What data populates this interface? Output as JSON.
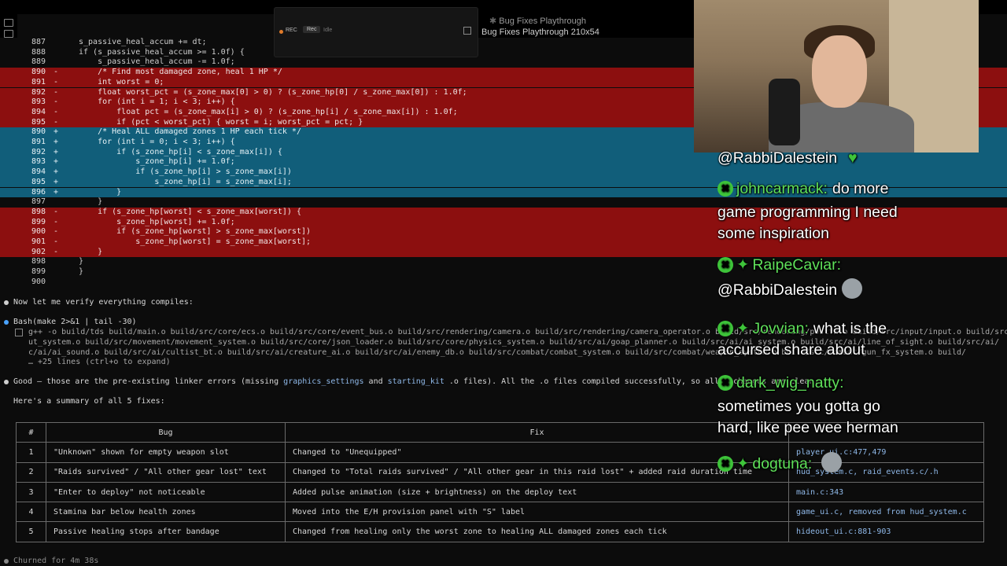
{
  "window": {
    "title": "Bug Fixes Playthrough",
    "subtitle": "Bug Fixes Playthrough 210x54"
  },
  "recorder": {
    "rec_label": "REC",
    "rec_button": "Rec",
    "idle_label": "Idle"
  },
  "diff_lines": [
    {
      "kind": "ctx",
      "ln": "887",
      "sign": "",
      "code": "s_passive_heal_accum += dt;"
    },
    {
      "kind": "ctx",
      "ln": "888",
      "sign": "",
      "code": "if (s_passive_heal_accum >= 1.0f) {"
    },
    {
      "kind": "ctx",
      "ln": "889",
      "sign": "",
      "code": "    s_passive_heal_accum -= 1.0f;"
    },
    {
      "kind": "del",
      "ln": "890",
      "sign": "-",
      "code": "    /* Find most damaged zone, heal 1 HP */"
    },
    {
      "kind": "del",
      "ln": "891",
      "sign": "-",
      "code": "    int worst = 0;"
    },
    {
      "kind": "del",
      "ln": "892",
      "sign": "-",
      "code": "    float worst_pct = (s_zone_max[0] > 0) ? (s_zone_hp[0] / s_zone_max[0]) : 1.0f;"
    },
    {
      "kind": "del",
      "ln": "893",
      "sign": "-",
      "code": "    for (int i = 1; i < 3; i++) {"
    },
    {
      "kind": "del",
      "ln": "894",
      "sign": "-",
      "code": "        float pct = (s_zone_max[i] > 0) ? (s_zone_hp[i] / s_zone_max[i]) : 1.0f;"
    },
    {
      "kind": "del",
      "ln": "895",
      "sign": "-",
      "code": "        if (pct < worst_pct) { worst = i; worst_pct = pct; }"
    },
    {
      "kind": "add",
      "ln": "890",
      "sign": "+",
      "code": "    /* Heal ALL damaged zones 1 HP each tick */"
    },
    {
      "kind": "add",
      "ln": "891",
      "sign": "+",
      "code": "    for (int i = 0; i < 3; i++) {"
    },
    {
      "kind": "add",
      "ln": "892",
      "sign": "+",
      "code": "        if (s_zone_hp[i] < s_zone_max[i]) {"
    },
    {
      "kind": "add",
      "ln": "893",
      "sign": "+",
      "code": "            s_zone_hp[i] += 1.0f;"
    },
    {
      "kind": "add",
      "ln": "894",
      "sign": "+",
      "code": "            if (s_zone_hp[i] > s_zone_max[i])"
    },
    {
      "kind": "add",
      "ln": "895",
      "sign": "+",
      "code": "                s_zone_hp[i] = s_zone_max[i];"
    },
    {
      "kind": "add",
      "ln": "896",
      "sign": "+",
      "code": "        }"
    },
    {
      "kind": "ctx",
      "ln": "897",
      "sign": "",
      "code": "    }"
    },
    {
      "kind": "del",
      "ln": "898",
      "sign": "-",
      "code": "    if (s_zone_hp[worst] < s_zone_max[worst]) {"
    },
    {
      "kind": "del",
      "ln": "899",
      "sign": "-",
      "code": "        s_zone_hp[worst] += 1.0f;"
    },
    {
      "kind": "del",
      "ln": "900",
      "sign": "-",
      "code": "        if (s_zone_hp[worst] > s_zone_max[worst])"
    },
    {
      "kind": "del",
      "ln": "901",
      "sign": "-",
      "code": "            s_zone_hp[worst] = s_zone_max[worst];"
    },
    {
      "kind": "del",
      "ln": "902",
      "sign": "-",
      "code": "    }"
    },
    {
      "kind": "ctx",
      "ln": "898",
      "sign": "",
      "code": "}"
    },
    {
      "kind": "ctx",
      "ln": "899",
      "sign": "",
      "code": "}"
    },
    {
      "kind": "ctx",
      "ln": "900",
      "sign": "",
      "code": ""
    }
  ],
  "messages": {
    "verify": "Now let me verify everything compiles:",
    "bash_cmd": "Bash(make 2>&1 | tail -30)",
    "bash_out_1": "g++ -o build/tds build/main.o build/src/core/ecs.o build/src/core/event_bus.o build/src/rendering/camera.o build/src/rendering/camera_operator.o build/src/rendering/postfx.o build/src/input/input.o build/src/input",
    "bash_out_2": "ut_system.o build/src/movement/movement_system.o build/src/core/json_loader.o build/src/core/physics_system.o build/src/ai/goap_planner.o build/src/ai/ai_system.o build/src/ai/line_of_sight.o build/src/ai/",
    "bash_out_3": "c/ai/ai_sound.o build/src/ai/cultist_bt.o build/src/ai/creature_ai.o build/src/ai/enemy_db.o build/src/combat/combat_system.o build/src/combat/weapon_system.o build/src/combat/gun_fx_system.o build/",
    "bash_more": "… +25 lines (ctrl+o to expand)",
    "good_pre": "Good — those are the pre-existing linker errors (missing ",
    "good_h1": "graphics_settings",
    "good_mid": " and ",
    "good_h2": "starting_kit",
    "good_post": " .o files). All the .o files compiled successfully, so all 5 changes are clean.",
    "summary": "Here's a summary of all 5 fixes:",
    "churned": "Churned for 4m 38s"
  },
  "table": {
    "headers": [
      "#",
      "Bug",
      "Fix",
      ""
    ],
    "rows": [
      {
        "num": "1",
        "bug": "\"Unknown\" shown for empty weapon slot",
        "fix": "Changed to \"Unequipped\"",
        "file": "player_ui.c:477,479"
      },
      {
        "num": "2",
        "bug": "\"Raids survived\" / \"All other gear lost\" text",
        "fix": "Changed to \"Total raids survived\" / \"All other gear in this raid lost\" + added raid duration time",
        "file": "hud_system.c, raid_events.c/.h"
      },
      {
        "num": "3",
        "bug": "\"Enter to deploy\" not noticeable",
        "fix": "Added pulse animation (size + brightness) on the deploy text",
        "file": "main.c:343"
      },
      {
        "num": "4",
        "bug": "Stamina bar below health zones",
        "fix": "Moved into the E/H provision panel with \"S\" label",
        "file": "game_ui.c, removed from hud_system.c"
      },
      {
        "num": "5",
        "bug": "Passive healing stops after bandage",
        "fix": "Changed from healing only the worst zone to healing ALL damaged zones each tick",
        "file": "hideout_ui.c:881-903"
      }
    ]
  },
  "chat": [
    {
      "user": "@RabbiDalestein",
      "text": "",
      "badge": false,
      "star": false,
      "heart": true
    },
    {
      "user": "johncarmack:",
      "text": "do more",
      "badge": true,
      "star": false
    },
    {
      "user": "",
      "text": "game programming I need",
      "badge": false,
      "star": false
    },
    {
      "user": "",
      "text": "some inspiration",
      "badge": false,
      "star": false
    },
    {
      "user": "RaipeCaviar:",
      "text": "",
      "badge": true,
      "star": true
    },
    {
      "user": "",
      "text": "@RabbiDalestein",
      "badge": false,
      "star": false,
      "emote": true
    },
    {
      "user": "Jovvian:",
      "text": "what is the",
      "badge": true,
      "star": true
    },
    {
      "user": "",
      "text": "accursed share about",
      "badge": false,
      "star": false
    },
    {
      "user": "dark_wig_natty:",
      "text": "",
      "badge": true,
      "star": false
    },
    {
      "user": "",
      "text": "sometimes you gotta go",
      "badge": false,
      "star": false
    },
    {
      "user": "",
      "text": "hard, like pee wee herman",
      "badge": false,
      "star": false
    },
    {
      "user": "dogtuna:",
      "text": "",
      "badge": true,
      "star": true,
      "emote": true
    }
  ],
  "colors": {
    "deleted_bg": "#8c0f0f",
    "added_bg": "#115e7a",
    "chat_user": "#5fe05a",
    "badge": "#3ec43a"
  }
}
